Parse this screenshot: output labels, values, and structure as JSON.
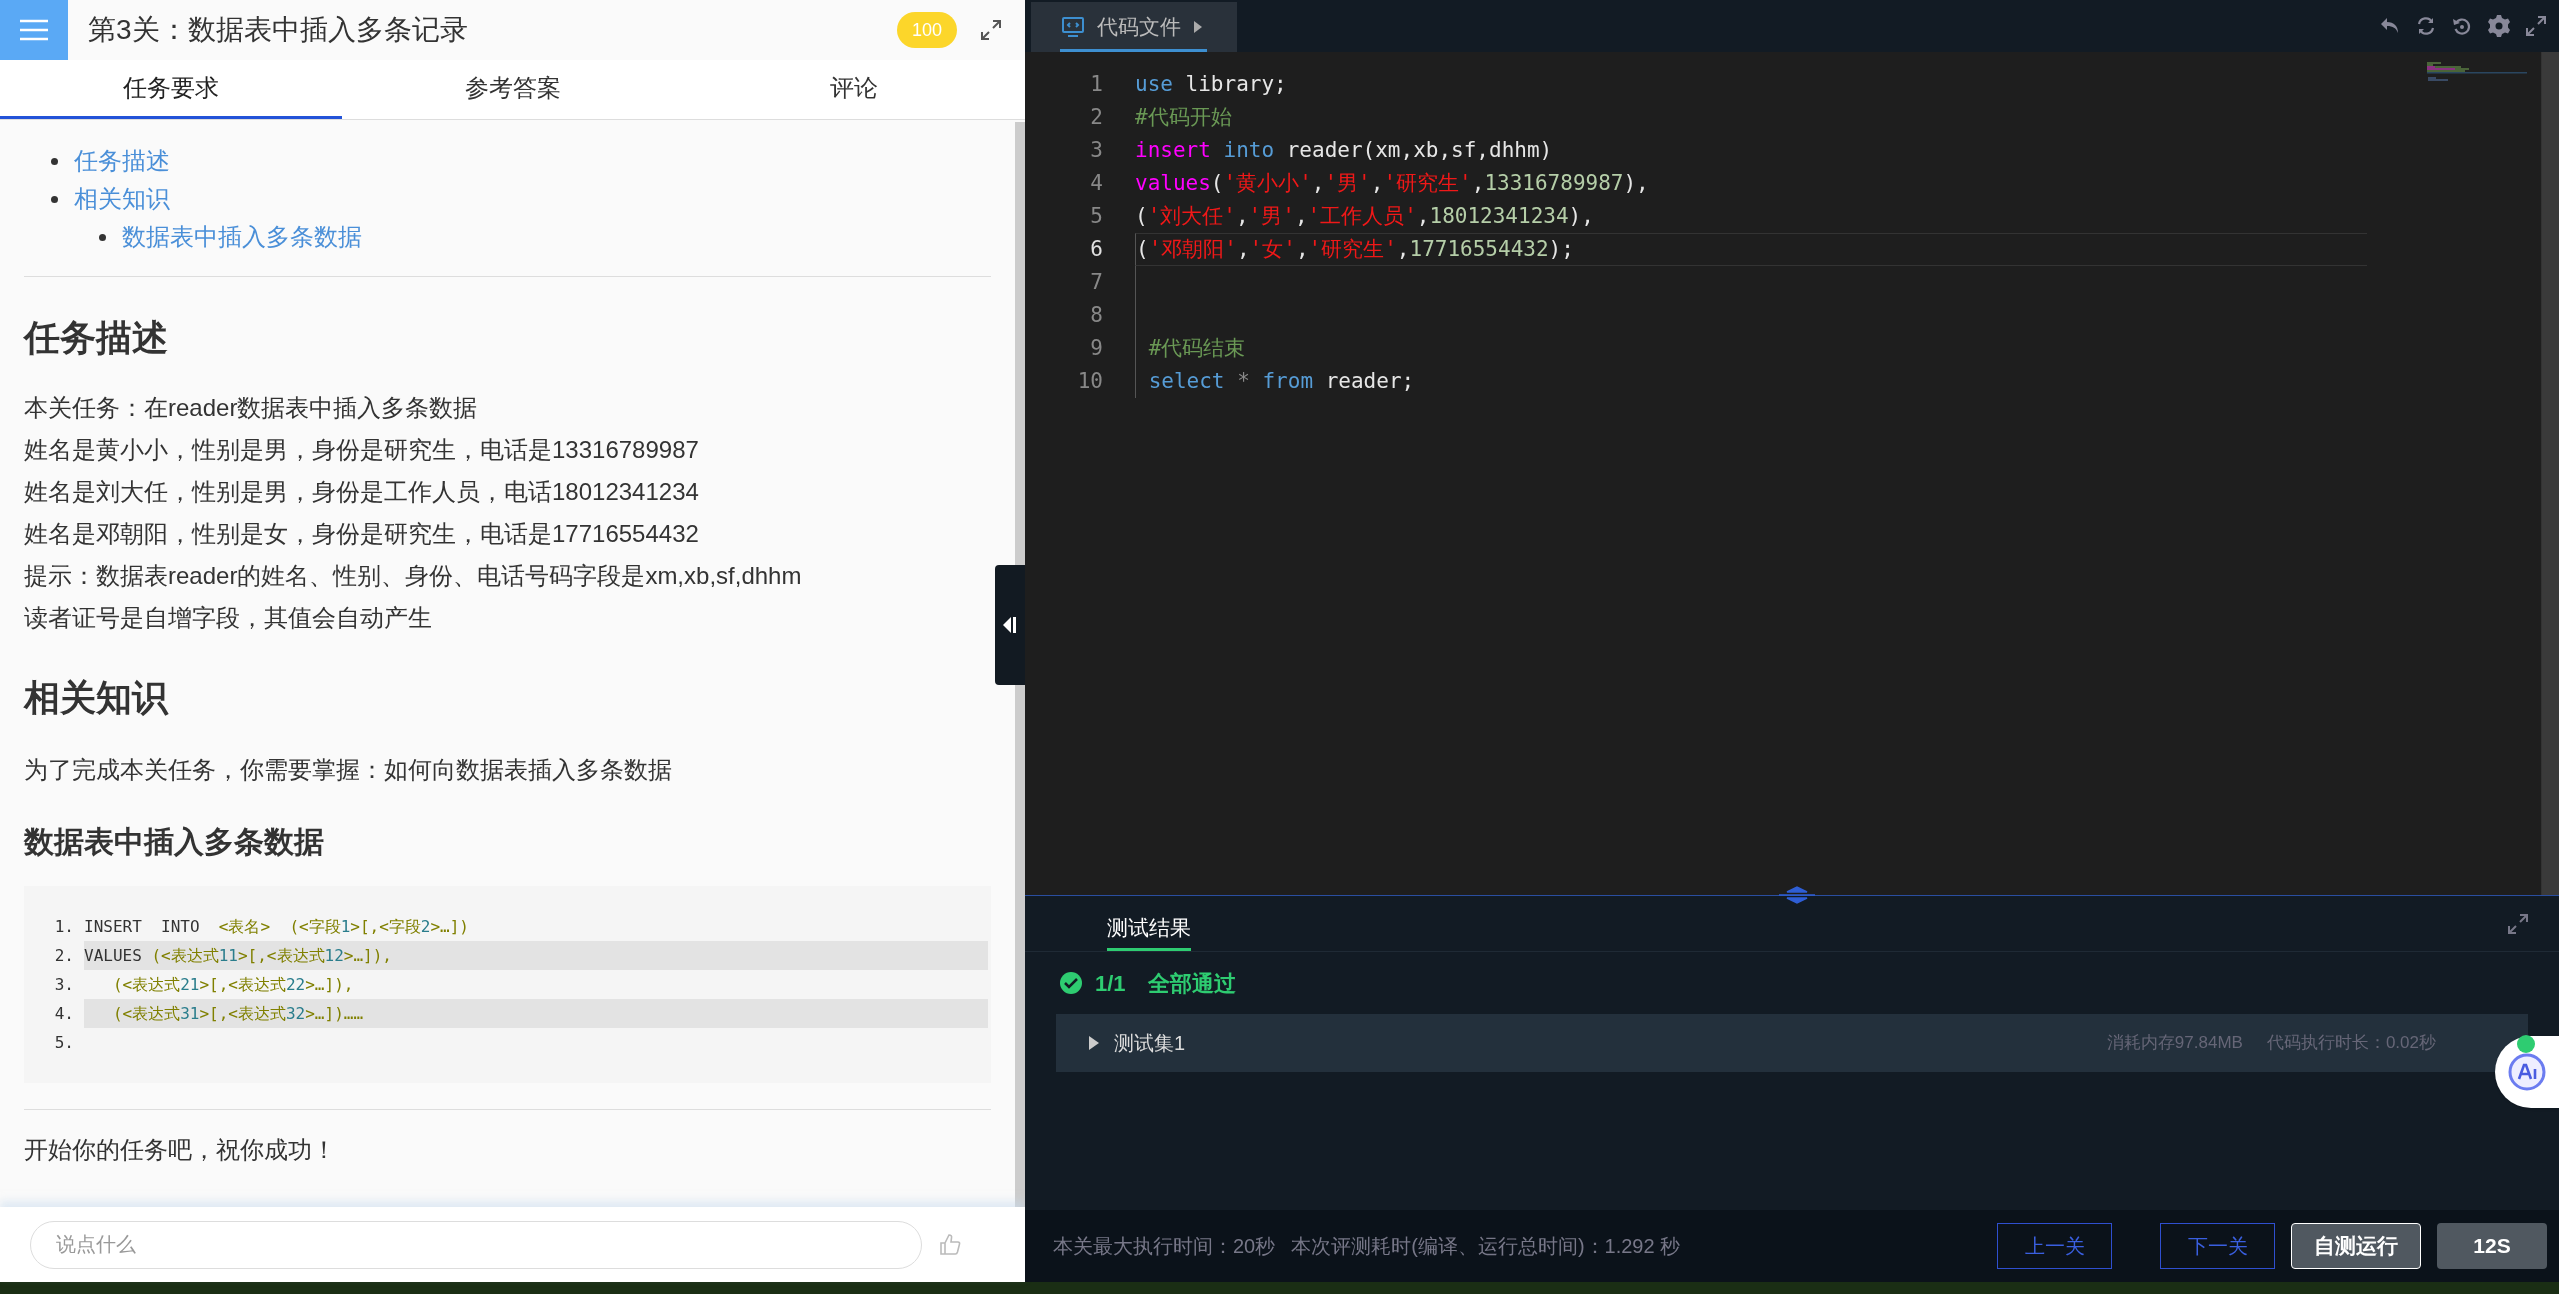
{
  "header": {
    "title": "第3关：数据表中插入多条记录",
    "score": "100"
  },
  "tabs": [
    {
      "label": "任务要求",
      "selected": true
    },
    {
      "label": "参考答案",
      "selected": false
    },
    {
      "label": "评论",
      "selected": false
    }
  ],
  "toc": [
    {
      "label": "任务描述"
    },
    {
      "label": "相关知识",
      "children": [
        {
          "label": "数据表中插入多条数据"
        }
      ]
    }
  ],
  "task": {
    "heading": "任务描述",
    "lines": [
      "本关任务：在reader数据表中插入多条数据",
      "姓名是黄小小，性别是男，身份是研究生，电话是13316789987",
      "姓名是刘大任，性别是男，身份是工作人员，电话18012341234",
      "姓名是邓朝阳，性别是女，身份是研究生，电话是17716554432",
      "提示：数据表reader的姓名、性别、身份、电话号码字段是xm,xb,sf,dhhm",
      "读者证号是自增字段，其值会自动产生"
    ]
  },
  "knowledge": {
    "heading": "相关知识",
    "text": "为了完成本关任务，你需要掌握：如何向数据表插入多条数据",
    "subheading": "数据表中插入多条数据",
    "code": [
      {
        "num": "1.",
        "highlighted": false,
        "tokens": [
          {
            "text": "INSERT  INTO  ",
            "kind": "plain"
          },
          {
            "text": "<表名>  (<字段",
            "kind": "tag"
          },
          {
            "text": "1",
            "kind": "num"
          },
          {
            "text": ">[,<字段",
            "kind": "tag"
          },
          {
            "text": "2",
            "kind": "num"
          },
          {
            "text": ">…])",
            "kind": "tag"
          }
        ]
      },
      {
        "num": "2.",
        "highlighted": true,
        "tokens": [
          {
            "text": "VALUES ",
            "kind": "plain"
          },
          {
            "text": "(<表达式",
            "kind": "tag"
          },
          {
            "text": "11",
            "kind": "num"
          },
          {
            "text": ">[,<表达式",
            "kind": "tag"
          },
          {
            "text": "12",
            "kind": "num"
          },
          {
            "text": ">…]),",
            "kind": "tag"
          }
        ]
      },
      {
        "num": "3.",
        "highlighted": false,
        "tokens": [
          {
            "text": "   (<表达式",
            "kind": "tag"
          },
          {
            "text": "21",
            "kind": "num"
          },
          {
            "text": ">[,<表达式",
            "kind": "tag"
          },
          {
            "text": "22",
            "kind": "num"
          },
          {
            "text": ">…]),",
            "kind": "tag"
          }
        ]
      },
      {
        "num": "4.",
        "highlighted": true,
        "tokens": [
          {
            "text": "   (<表达式",
            "kind": "tag"
          },
          {
            "text": "31",
            "kind": "num"
          },
          {
            "text": ">[,<表达式",
            "kind": "tag"
          },
          {
            "text": "32",
            "kind": "num"
          },
          {
            "text": ">…])……",
            "kind": "tag"
          }
        ]
      },
      {
        "num": "5.",
        "highlighted": false
      }
    ]
  },
  "closing": "开始你的任务吧，祝你成功！",
  "comment": {
    "placeholder": "说点什么"
  },
  "editor": {
    "tab": "代码文件",
    "lines": [
      {
        "num": "1",
        "current": false,
        "tokens": [
          {
            "text": "use",
            "kind": "kw"
          },
          {
            "text": " library;",
            "kind": "plain"
          }
        ]
      },
      {
        "num": "2",
        "current": false,
        "tokens": [
          {
            "text": "#代码开始",
            "kind": "comment"
          }
        ]
      },
      {
        "num": "3",
        "current": false,
        "tokens": [
          {
            "text": "insert",
            "kind": "kw2"
          },
          {
            "text": " into",
            "kind": "kw"
          },
          {
            "text": " reader(xm,xb,sf,dhhm)",
            "kind": "plain"
          }
        ]
      },
      {
        "num": "4",
        "current": false,
        "tokens": [
          {
            "text": "values",
            "kind": "kw2"
          },
          {
            "text": "(",
            "kind": "plain"
          },
          {
            "text": "'黄小小'",
            "kind": "str"
          },
          {
            "text": ",",
            "kind": "plain"
          },
          {
            "text": "'男'",
            "kind": "str"
          },
          {
            "text": ",",
            "kind": "plain"
          },
          {
            "text": "'研究生'",
            "kind": "str"
          },
          {
            "text": ",",
            "kind": "plain"
          },
          {
            "text": "13316789987",
            "kind": "num"
          },
          {
            "text": "),",
            "kind": "plain"
          }
        ]
      },
      {
        "num": "5",
        "current": false,
        "tokens": [
          {
            "text": "(",
            "kind": "plain"
          },
          {
            "text": "'刘大任'",
            "kind": "str"
          },
          {
            "text": ",",
            "kind": "plain"
          },
          {
            "text": "'男'",
            "kind": "str"
          },
          {
            "text": ",",
            "kind": "plain"
          },
          {
            "text": "'工作人员'",
            "kind": "str"
          },
          {
            "text": ",",
            "kind": "plain"
          },
          {
            "text": "18012341234",
            "kind": "num"
          },
          {
            "text": "),",
            "kind": "plain"
          }
        ]
      },
      {
        "num": "6",
        "current": true,
        "tokens": [
          {
            "text": "(",
            "kind": "plain"
          },
          {
            "text": "'邓朝阳'",
            "kind": "str"
          },
          {
            "text": ",",
            "kind": "plain"
          },
          {
            "text": "'女'",
            "kind": "str"
          },
          {
            "text": ",",
            "kind": "plain"
          },
          {
            "text": "'研究生'",
            "kind": "str"
          },
          {
            "text": ",",
            "kind": "plain"
          },
          {
            "text": "17716554432",
            "kind": "num"
          },
          {
            "text": ");",
            "kind": "plain"
          }
        ]
      },
      {
        "num": "7",
        "current": false
      },
      {
        "num": "8",
        "current": false
      },
      {
        "num": "9",
        "current": false,
        "tokens": [
          {
            "text": " #代码结束",
            "kind": "comment"
          }
        ]
      },
      {
        "num": "10",
        "current": false,
        "tokens": [
          {
            "text": " select",
            "kind": "kw"
          },
          {
            "text": " * ",
            "kind": "op"
          },
          {
            "text": "from",
            "kind": "kw"
          },
          {
            "text": " reader;",
            "kind": "plain"
          }
        ]
      }
    ]
  },
  "results": {
    "tab": "测试结果",
    "count": "1/1",
    "status": "全部通过",
    "set": {
      "name": "测试集1",
      "memory": "消耗内存97.84MB",
      "duration": "代码执行时长：0.02秒",
      "passed": true
    }
  },
  "footer": {
    "max_time": "本关最大执行时间：20秒",
    "elapsed": "本次评测耗时(编译、运行总时间)：1.292 秒",
    "buttons": [
      {
        "label": "上一关",
        "kind": "outline"
      },
      {
        "label": "下一关",
        "kind": "outline"
      },
      {
        "label": "自测运行",
        "kind": "run"
      },
      {
        "label": "12S",
        "kind": "submit"
      }
    ]
  }
}
